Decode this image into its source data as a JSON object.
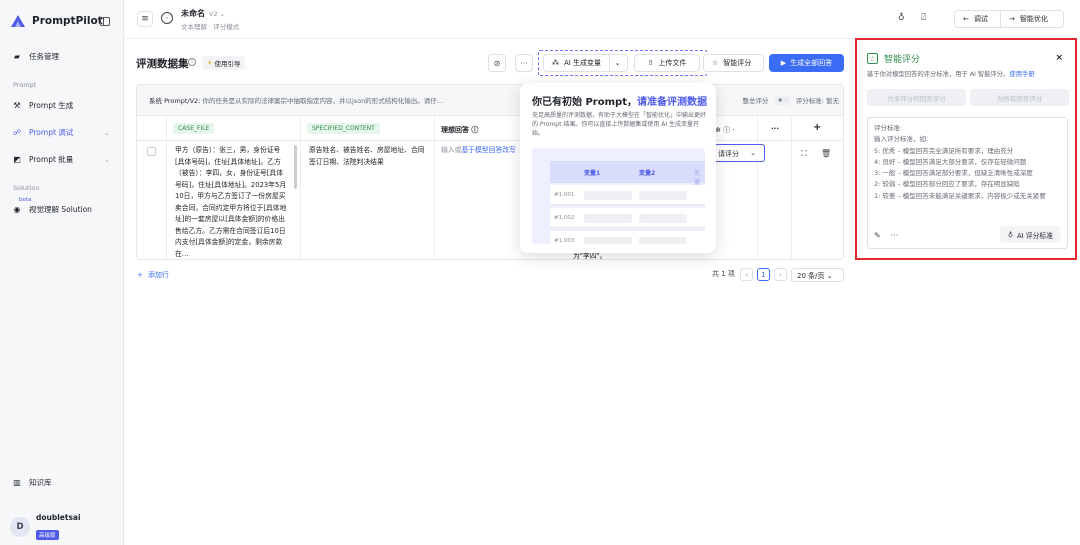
{
  "sidebar": {
    "logo": "PromptPilot",
    "items": [
      {
        "label": "任务管理"
      },
      {
        "label": "Prompt 生成"
      },
      {
        "label": "Prompt 调试"
      },
      {
        "label": "Prompt 批量"
      },
      {
        "label": "视觉理解 Solution"
      },
      {
        "label": "知识库"
      }
    ],
    "sections": [
      "Prompt",
      "Solution"
    ],
    "beta": "beta",
    "user": {
      "initial": "D",
      "name": "doubletsai",
      "badge": "高级版"
    }
  },
  "topbar": {
    "title": "未命名",
    "version": "V2",
    "subtitle": "文本理解 · 评分模式",
    "debug_label": "调试",
    "optimize_label": "智能优化"
  },
  "main": {
    "title": "评测数据集",
    "guide_label": "使用引导",
    "ai_gen_label": "AI 生成变量",
    "upload_label": "上传文件",
    "smart_score_label": "智能评分",
    "generate_all_label": "生成全部回答",
    "system_prompt": "系统 Prompt/V2:",
    "system_prompt_text": "你的任务是从实际的法律案宗中抽取指定内容，并以json的形式结构化输出。请仔…",
    "score_total": "整总评分",
    "score_standard": "评分标准: 暂无",
    "columns": [
      "CASE_FILE",
      "SPECIFIED_CONTENT",
      "理想回答"
    ],
    "row": {
      "case_file": "甲方（原告）：张三，男，身份证号[具体号码]，住址[具体地址]。乙方（被告）：李四，女，身份证号[具体号码]，住址[具体地址]。2023年5月10日，甲方与乙方签订了一份房屋买卖合同，合同约定甲方将位于[具体地址]的一套房屋以[具体金额]的价格出售给乙方。乙方需在合同签订后10日内支付[具体金额]的定金，剩余房款在…",
      "specified_content": "原告姓名、被告姓名、房屋地址、合同签订日期、法院判决结果",
      "ideal_placeholder": "输入或",
      "ideal_link": "基于模型回答改写",
      "score_select": "请评分",
      "answer_tail": "为\"李四\"。"
    },
    "add_row_label": "添加行",
    "pager": {
      "total": "共 1 项",
      "current": "1",
      "size": "20 条/页"
    }
  },
  "popover": {
    "title": "你已有初始 Prompt，",
    "title_link": "请准备评测数据",
    "desc": "充足高质量的评测数据，有助于大模型在「智能优化」中输出更好的 Prompt 结果。你可以直接上传数据集或使用 AI 生成变量开始。",
    "var1": "变量1",
    "var2": "变量2",
    "var3": "变量",
    "ids": [
      "#1,001",
      "#1,002",
      "#1,003"
    ]
  },
  "right_panel": {
    "title": "智能评分",
    "desc": "基于你对模型回答的评分标准，用于 AI 智能评分。",
    "desc_link": "使用手册",
    "btn_unscored": "为未评分的回答评分",
    "btn_all": "为所有回答评分",
    "criteria_text": "评分标准:\n输入评分标准，如:\n5: 优秀 – 模型回答完全满足所有要求，理由充分\n4: 良好 – 模型回答满足大部分要求，仅存在轻微问题\n3: 一般 – 模型回答满足部分要求，但缺乏清晰性或深度\n2: 较弱 – 模型回答部分回应了要求，存在明显缺陷\n1: 较差 – 模型回答未能满足关键要求，内容极少或无关紧要",
    "ai_standard_label": "AI 评分标准"
  }
}
